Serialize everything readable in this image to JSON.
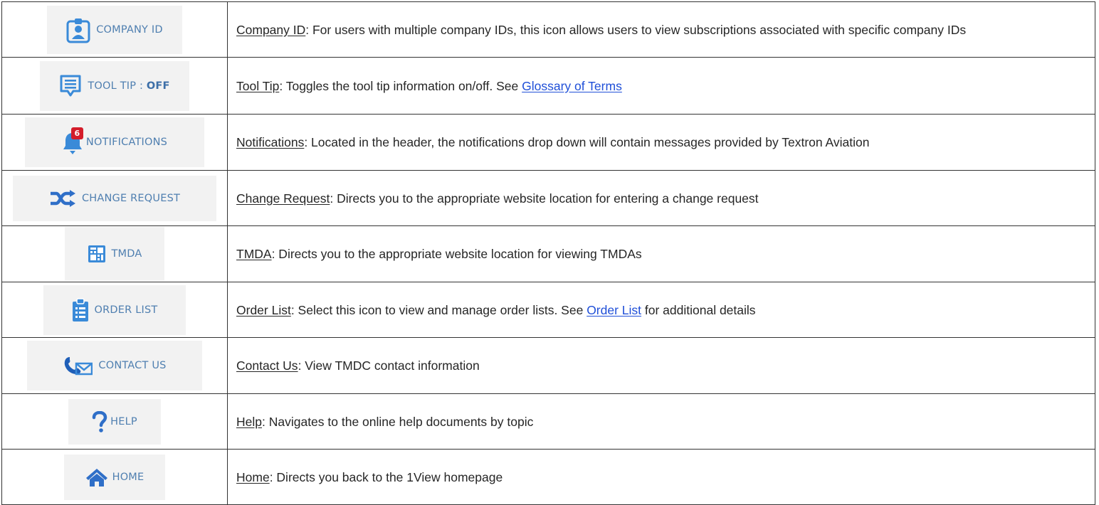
{
  "colors": {
    "chip_background": "#f2f2f2",
    "chip_text": "#4f7fb0",
    "icon_blue": "#3a8ad8",
    "link": "#1f4fd8",
    "badge": "#d41c2a"
  },
  "rows": [
    {
      "icon": "company-id-badge-icon",
      "button_label": "COMPANY ID",
      "term": "Company ID",
      "description": ": For users with multiple company IDs, this icon allows users to view subscriptions associated with specific company IDs"
    },
    {
      "icon": "tool-tip-message-icon",
      "button_label": "TOOL TIP : ",
      "button_state": "OFF",
      "term": "Tool Tip",
      "description": ": Toggles the tool tip information on/off. See ",
      "link_text": "Glossary of Terms"
    },
    {
      "icon": "notification-bell-icon",
      "badge_count": "6",
      "button_label": "NOTIFICATIONS",
      "term": "Notifications",
      "description": ": Located in the header, the notifications drop down will contain messages provided by Textron Aviation"
    },
    {
      "icon": "shuffle-icon",
      "button_label": "CHANGE REQUEST",
      "term": "Change Request",
      "description": ": Directs you to the appropriate website location for entering a change request"
    },
    {
      "icon": "tmda-grid-icon",
      "button_label": "TMDA",
      "term": "TMDA",
      "description": ": Directs you to the appropriate website location for viewing TMDAs"
    },
    {
      "icon": "clipboard-list-icon",
      "button_label": "ORDER LIST",
      "term": "Order List",
      "description": ": Select this icon to view and manage order lists. See ",
      "link_text": "Order List",
      "description_suffix": " for additional details"
    },
    {
      "icon": "phone-envelope-icon",
      "button_label": "CONTACT US",
      "term": "Contact Us",
      "description": ": View TMDC contact information"
    },
    {
      "icon": "question-mark-icon",
      "button_label": "HELP",
      "term": "Help",
      "description": ": Navigates to the online help documents by topic"
    },
    {
      "icon": "home-icon",
      "button_label": "HOME",
      "term": "Home",
      "description": ": Directs you back to the 1View homepage"
    }
  ]
}
